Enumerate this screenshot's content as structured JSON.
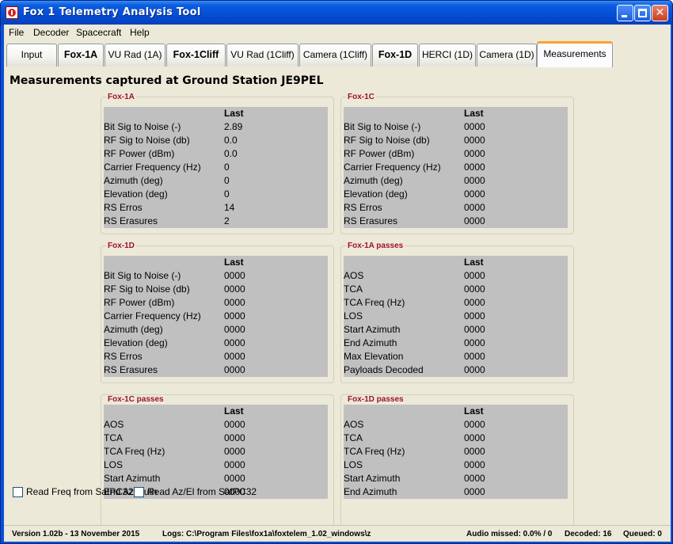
{
  "window": {
    "title": "Fox 1 Telemetry Analysis Tool",
    "minimize": "_",
    "maximize": "□",
    "close": "✕"
  },
  "menu": [
    "File",
    "Decoder",
    "Spacecraft",
    "Help"
  ],
  "tabs": [
    {
      "label": "Input",
      "bold": false,
      "active": false
    },
    {
      "label": "Fox-1A",
      "bold": true,
      "active": false
    },
    {
      "label": "VU Rad (1A)",
      "bold": false,
      "active": false
    },
    {
      "label": "Fox-1Cliff",
      "bold": true,
      "active": false
    },
    {
      "label": "VU Rad (1Cliff)",
      "bold": false,
      "active": false
    },
    {
      "label": "Camera (1Cliff)",
      "bold": false,
      "active": false
    },
    {
      "label": "Fox-1D",
      "bold": true,
      "active": false
    },
    {
      "label": "HERCI (1D)",
      "bold": false,
      "active": false
    },
    {
      "label": "Camera (1D)",
      "bold": false,
      "active": false
    },
    {
      "label": "Measurements",
      "bold": false,
      "active": true
    }
  ],
  "heading": "Measurements captured at Ground Station JE9PEL",
  "groups": [
    {
      "title": "Fox-1A",
      "column": "Last",
      "rows": [
        {
          "label": "Bit Sig to Noise (-)",
          "value": "2.89"
        },
        {
          "label": "RF Sig to Noise (db)",
          "value": "0.0"
        },
        {
          "label": "RF Power (dBm)",
          "value": "0.0"
        },
        {
          "label": "Carrier Frequency (Hz)",
          "value": "0"
        },
        {
          "label": "Azimuth (deg)",
          "value": "0"
        },
        {
          "label": "Elevation (deg)",
          "value": "0"
        },
        {
          "label": "RS Erros",
          "value": "14"
        },
        {
          "label": "RS Erasures",
          "value": "2"
        }
      ]
    },
    {
      "title": "Fox-1C",
      "column": "Last",
      "rows": [
        {
          "label": "Bit Sig to Noise (-)",
          "value": "0000"
        },
        {
          "label": "RF Sig to Noise (db)",
          "value": "0000"
        },
        {
          "label": "RF Power (dBm)",
          "value": "0000"
        },
        {
          "label": "Carrier Frequency (Hz)",
          "value": "0000"
        },
        {
          "label": "Azimuth (deg)",
          "value": "0000"
        },
        {
          "label": "Elevation (deg)",
          "value": "0000"
        },
        {
          "label": "RS Erros",
          "value": "0000"
        },
        {
          "label": "RS Erasures",
          "value": "0000"
        }
      ]
    },
    {
      "title": "Fox-1D",
      "column": "Last",
      "rows": [
        {
          "label": "Bit Sig to Noise (-)",
          "value": "0000"
        },
        {
          "label": "RF Sig to Noise (db)",
          "value": "0000"
        },
        {
          "label": "RF Power (dBm)",
          "value": "0000"
        },
        {
          "label": "Carrier Frequency (Hz)",
          "value": "0000"
        },
        {
          "label": "Azimuth (deg)",
          "value": "0000"
        },
        {
          "label": "Elevation (deg)",
          "value": "0000"
        },
        {
          "label": "RS Erros",
          "value": "0000"
        },
        {
          "label": "RS Erasures",
          "value": "0000"
        }
      ]
    },
    {
      "title": "Fox-1A passes",
      "column": "Last",
      "rows": [
        {
          "label": "AOS",
          "value": "0000"
        },
        {
          "label": "TCA",
          "value": "0000"
        },
        {
          "label": "TCA Freq (Hz)",
          "value": "0000"
        },
        {
          "label": "LOS",
          "value": "0000"
        },
        {
          "label": "Start Azimuth",
          "value": "0000"
        },
        {
          "label": "End Azimuth",
          "value": "0000"
        },
        {
          "label": "Max Elevation",
          "value": "0000"
        },
        {
          "label": "Payloads Decoded",
          "value": "0000"
        }
      ]
    },
    {
      "title": "Fox-1C passes",
      "column": "Last",
      "rows": [
        {
          "label": "AOS",
          "value": "0000"
        },
        {
          "label": "TCA",
          "value": "0000"
        },
        {
          "label": "TCA Freq (Hz)",
          "value": "0000"
        },
        {
          "label": "LOS",
          "value": "0000"
        },
        {
          "label": "Start Azimuth",
          "value": "0000"
        },
        {
          "label": "End Azimuth",
          "value": "0000"
        }
      ]
    },
    {
      "title": "Fox-1D passes",
      "column": "Last",
      "rows": [
        {
          "label": "AOS",
          "value": "0000"
        },
        {
          "label": "TCA",
          "value": "0000"
        },
        {
          "label": "TCA Freq (Hz)",
          "value": "0000"
        },
        {
          "label": "LOS",
          "value": "0000"
        },
        {
          "label": "Start Azimuth",
          "value": "0000"
        },
        {
          "label": "End Azimuth",
          "value": "0000"
        }
      ]
    }
  ],
  "checkboxes": [
    {
      "label": "Read Freq from SatPC32",
      "checked": false
    },
    {
      "label": "Read Az/El from SatPC32",
      "checked": false
    }
  ],
  "status": {
    "version": "Version 1.02b - 13 November 2015",
    "logs": "Logs: C:\\Program Files\\fox1a\\foxtelem_1.02_windows\\z",
    "audio": "Audio missed: 0.0% / 0",
    "decoded": "Decoded: 16",
    "queued": "Queued: 0"
  }
}
